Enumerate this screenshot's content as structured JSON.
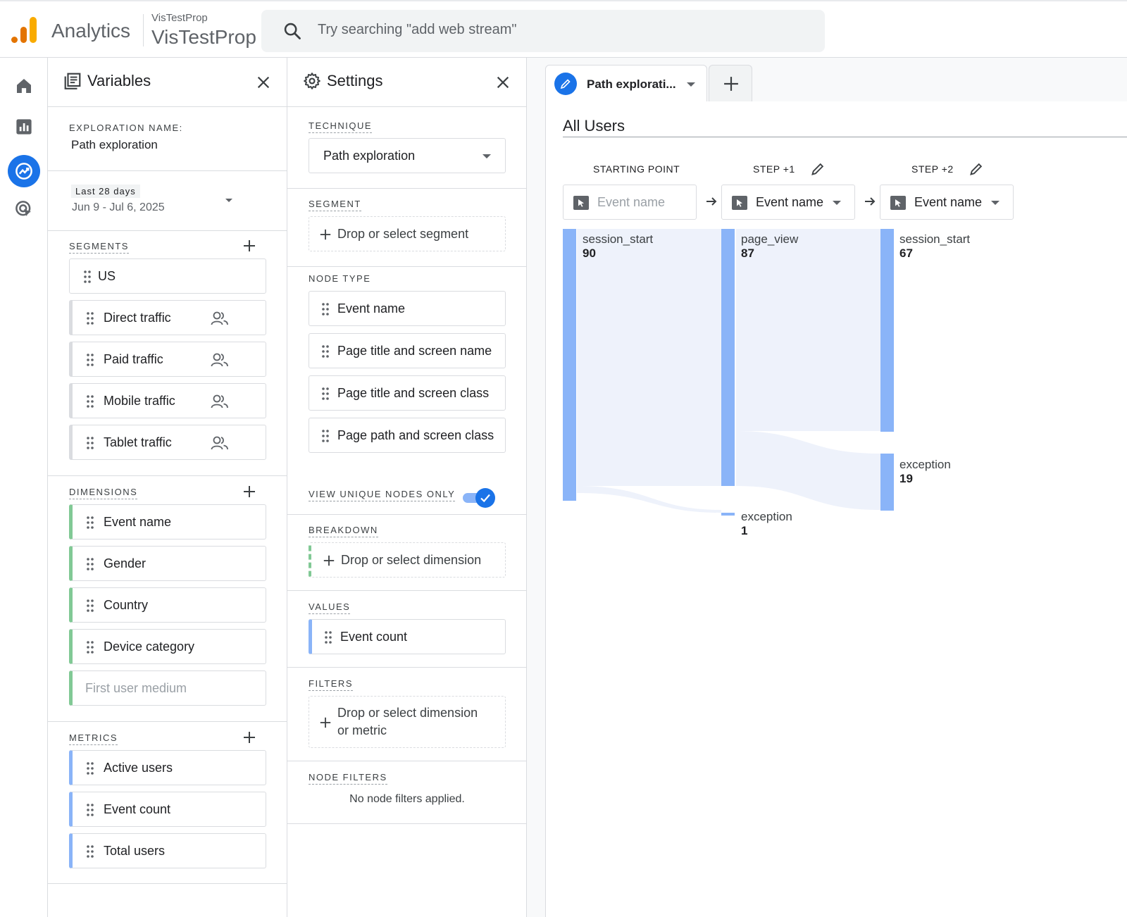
{
  "header": {
    "app_title": "Analytics",
    "property_small": "VisTestProp",
    "property_big": "VisTestProp",
    "search_placeholder": "Try searching \"add web stream\""
  },
  "left_nav": {
    "icons": [
      "home-icon",
      "reports-icon",
      "explore-icon",
      "advertising-icon"
    ],
    "active": "explore-icon"
  },
  "variables": {
    "title": "Variables",
    "exploration_name_label": "EXPLORATION NAME:",
    "exploration_name": "Path exploration",
    "date_badge": "Last 28 days",
    "date_range": "Jun 9 - Jul 6, 2025",
    "segments_label": "SEGMENTS",
    "segments": [
      "US",
      "Direct traffic",
      "Paid traffic",
      "Mobile traffic",
      "Tablet traffic"
    ],
    "dimensions_label": "DIMENSIONS",
    "dimensions": [
      "Event name",
      "Gender",
      "Country",
      "Device category",
      "First user medium"
    ],
    "metrics_label": "METRICS",
    "metrics": [
      "Active users",
      "Event count",
      "Total users"
    ]
  },
  "settings": {
    "title": "Settings",
    "technique_label": "TECHNIQUE",
    "technique": "Path exploration",
    "segment_label": "SEGMENT",
    "segment_placeholder": "Drop or select segment",
    "node_type_label": "NODE TYPE",
    "node_types": [
      "Event name",
      "Page title and screen name",
      "Page title and screen class",
      "Page path and screen class"
    ],
    "unique_nodes_label": "VIEW UNIQUE NODES ONLY",
    "unique_nodes_on": true,
    "breakdown_label": "BREAKDOWN",
    "breakdown_placeholder": "Drop or select dimension",
    "values_label": "VALUES",
    "values": "Event count",
    "filters_label": "FILTERS",
    "filters_line1": "Drop or select dimension",
    "filters_line2": "or metric",
    "node_filters_label": "NODE FILTERS",
    "node_filters_text": "No node filters applied."
  },
  "canvas": {
    "tab_label": "Path explorati...",
    "segment_title": "All Users",
    "steps": [
      {
        "label": "STARTING POINT",
        "selector": "Event name",
        "placeholder": true
      },
      {
        "label": "STEP +1",
        "selector": "Event name",
        "placeholder": false
      },
      {
        "label": "STEP +2",
        "selector": "Event name",
        "placeholder": false
      }
    ],
    "nodes": {
      "start_session_start": {
        "name": "session_start",
        "value": "90"
      },
      "step1_page_view": {
        "name": "page_view",
        "value": "87"
      },
      "step1_exception": {
        "name": "exception",
        "value": "1"
      },
      "step2_session_start": {
        "name": "session_start",
        "value": "67"
      },
      "step2_exception": {
        "name": "exception",
        "value": "19"
      }
    },
    "colors": {
      "node": "#8ab4f8",
      "flow": "#eef2fb",
      "accent": "#1a73e8"
    }
  }
}
